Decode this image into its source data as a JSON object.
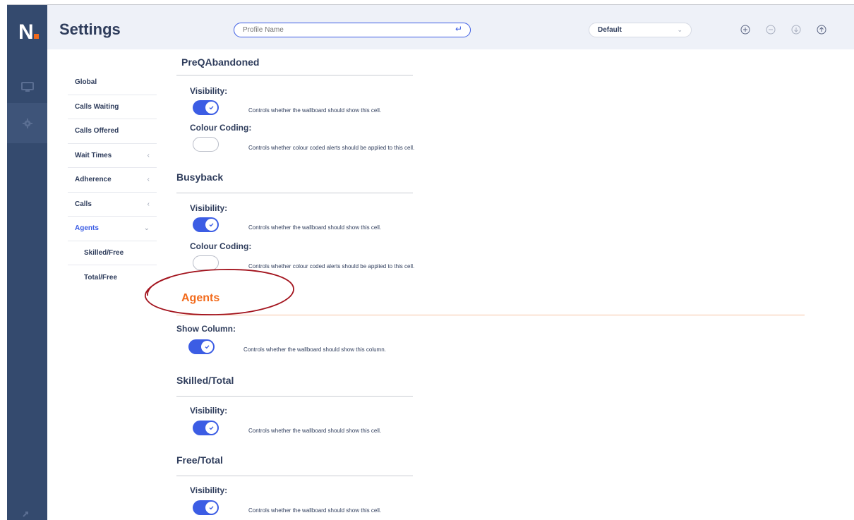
{
  "app": {
    "logo_text": "N",
    "title": "Settings"
  },
  "header": {
    "profile_placeholder": "Profile Name",
    "profile_value": "",
    "enter_glyph": "↵",
    "profile_select": "Default",
    "icons": [
      "add-circle-icon",
      "remove-circle-icon",
      "download-circle-icon",
      "upload-circle-icon"
    ]
  },
  "rail": {
    "icons": [
      "monitor-icon",
      "gear-icon",
      "logout-icon"
    ]
  },
  "subnav": {
    "items": [
      {
        "label": "Global",
        "chevron": ""
      },
      {
        "label": "Calls Waiting",
        "chevron": ""
      },
      {
        "label": "Calls Offered",
        "chevron": ""
      },
      {
        "label": "Wait Times",
        "chevron": "‹"
      },
      {
        "label": "Adherence",
        "chevron": "‹"
      },
      {
        "label": "Calls",
        "chevron": "‹"
      },
      {
        "label": "Agents",
        "chevron": "⌄",
        "active": true
      }
    ],
    "sub_items": [
      {
        "label": "Skilled/Free"
      },
      {
        "label": "Total/Free"
      }
    ]
  },
  "content": {
    "preq": {
      "title": "PreQAbandoned",
      "visibility_label": "Visibility:",
      "visibility_on": true,
      "visibility_desc": "Controls whether the wallboard should show this cell.",
      "colour_label": "Colour Coding:",
      "colour_on": false,
      "colour_desc": "Controls whether colour coded alerts should be applied to this cell."
    },
    "busyback": {
      "title": "Busyback",
      "visibility_label": "Visibility:",
      "visibility_on": true,
      "visibility_desc": "Controls whether the wallboard should show this cell.",
      "colour_label": "Colour Coding:",
      "colour_on": false,
      "colour_desc": "Controls whether colour coded alerts should be applied to this cell."
    },
    "agents": {
      "title": "Agents",
      "show_label": "Show Column:",
      "show_on": true,
      "show_desc": "Controls whether the wallboard should show this column."
    },
    "skilled_total": {
      "title": "Skilled/Total",
      "visibility_label": "Visibility:",
      "visibility_on": true,
      "visibility_desc": "Controls whether the wallboard should show this cell."
    },
    "free_total": {
      "title": "Free/Total",
      "visibility_label": "Visibility:",
      "visibility_on": true,
      "visibility_desc": "Controls whether the wallboard should show this cell."
    }
  },
  "colors": {
    "accent": "#3c5de4",
    "rail": "#344a6e",
    "header_bg": "#eef1f8",
    "orange": "#f26a1b",
    "annotation": "#a3141e"
  }
}
